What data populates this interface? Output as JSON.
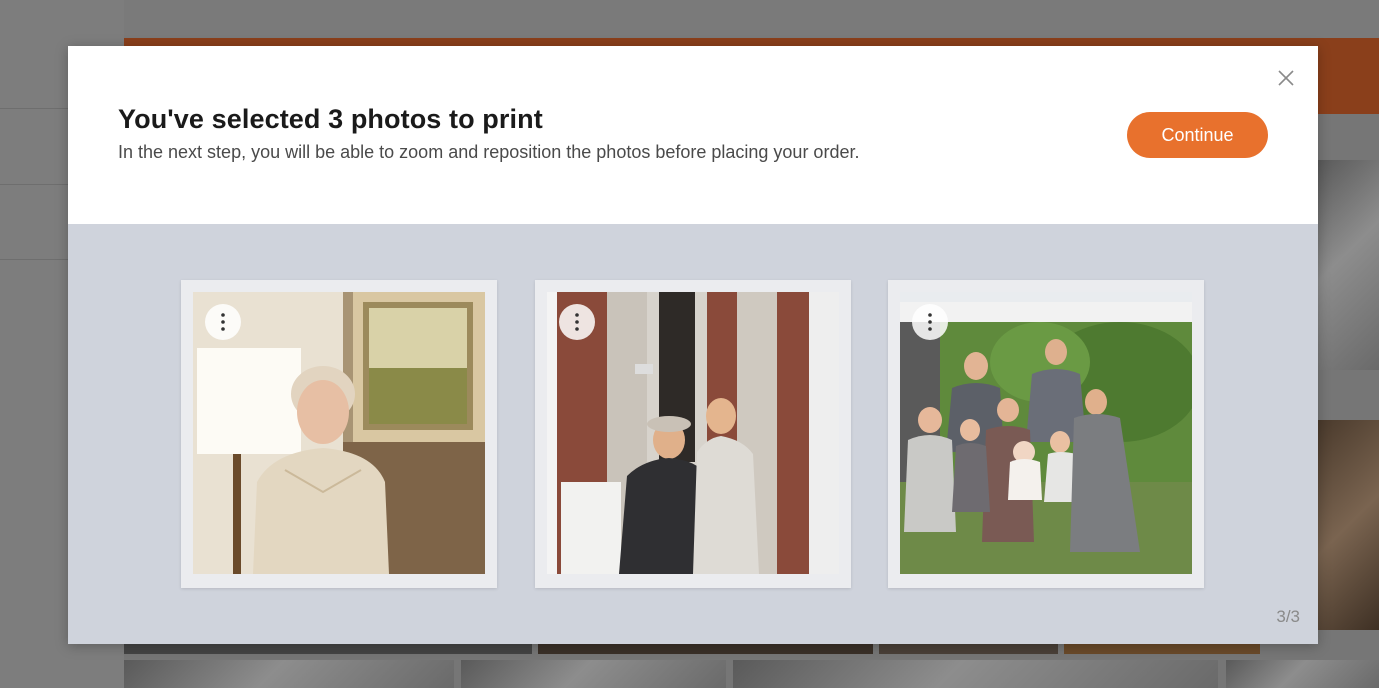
{
  "modal": {
    "title": "You've selected 3 photos to print",
    "subtitle": "In the next step, you will be able to zoom and reposition the photos before placing your order.",
    "continue_label": "Continue",
    "close_icon": "close-icon",
    "counter": "3/3"
  },
  "photos": [
    {
      "subject": "elderly woman beside lamp and painting",
      "menu_icon": "more-vertical-icon"
    },
    {
      "subject": "two men in front of brick building",
      "menu_icon": "more-vertical-icon"
    },
    {
      "subject": "family group photo outdoors",
      "menu_icon": "more-vertical-icon"
    }
  ],
  "colors": {
    "accent": "#e8712d",
    "modal_body": "#cfd3dc",
    "header_bg": "#ffffff"
  }
}
